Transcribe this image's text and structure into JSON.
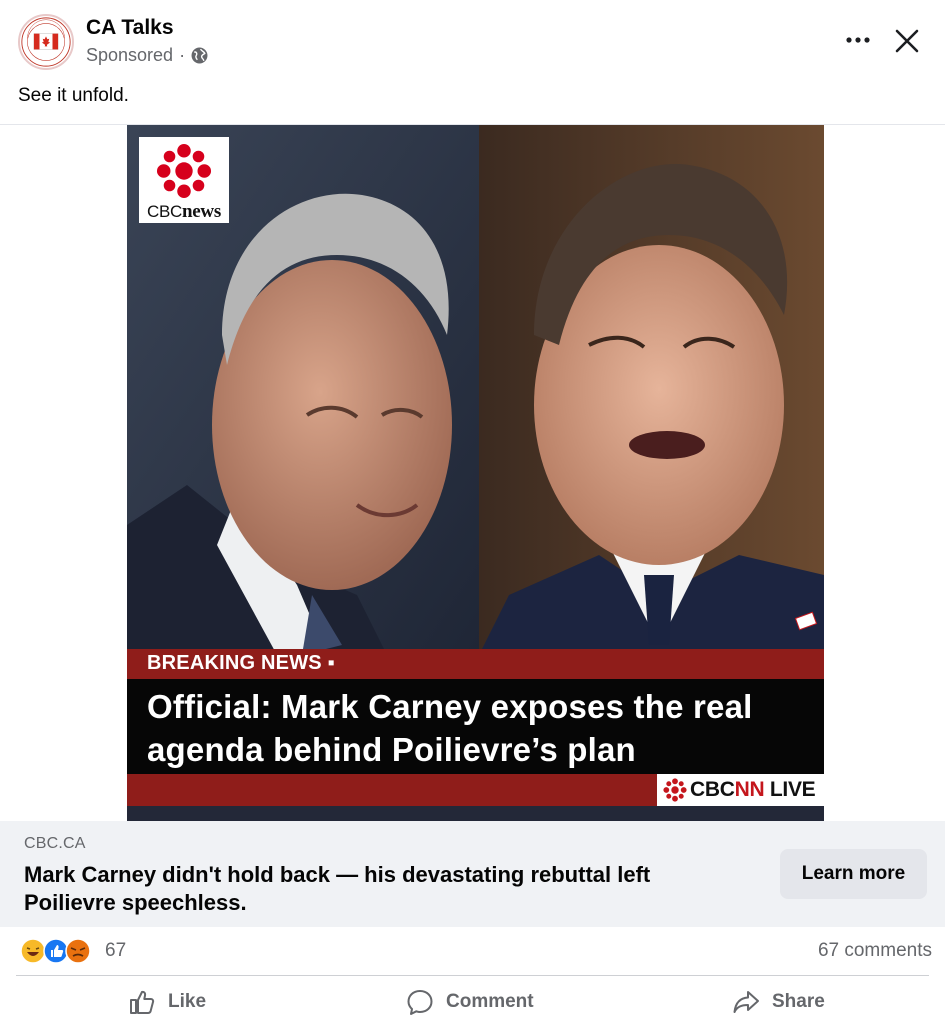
{
  "post": {
    "page_name": "CA Talks",
    "sponsored_label": "Sponsored",
    "separator": "·",
    "caption": "See it unfold.",
    "avatar_text_top": "TRUE NORTH",
    "avatar_text_bottom": "STRONG&FREE"
  },
  "icons": {
    "globe": "globe-icon",
    "more": "more-options-icon",
    "close": "close-icon",
    "like": "thumbs-up-icon",
    "comment": "comment-bubble-icon",
    "share": "share-arrow-icon"
  },
  "creative": {
    "logo_word_cbc": "CBC",
    "logo_word_news": "news",
    "breaking_label": "BREAKING NEWS ▪",
    "headline": "Official: Mark Carney exposes the real agenda behind Poilievre’s plan",
    "live_badge_cbc": "CBC",
    "live_badge_nn": "NN",
    "live_badge_live": " LIVE",
    "colors": {
      "bar_red": "#8f1d1a",
      "headline_bg": "#060606",
      "cbc_red": "#c4161c"
    }
  },
  "link_preview": {
    "domain": "CBC.CA",
    "title": "Mark Carney didn't hold back — his devastating rebuttal left Poilievre speechless.",
    "cta_label": "Learn more"
  },
  "engagement": {
    "reaction_types": [
      "haha",
      "like",
      "angry"
    ],
    "reaction_count": "67",
    "comments_label": "67 comments"
  },
  "actions": {
    "like_label": "Like",
    "comment_label": "Comment",
    "share_label": "Share"
  },
  "theme": {
    "text_primary": "#050505",
    "text_secondary": "#65676b",
    "link_box_bg": "#f0f2f5",
    "button_bg": "#e4e6eb"
  }
}
